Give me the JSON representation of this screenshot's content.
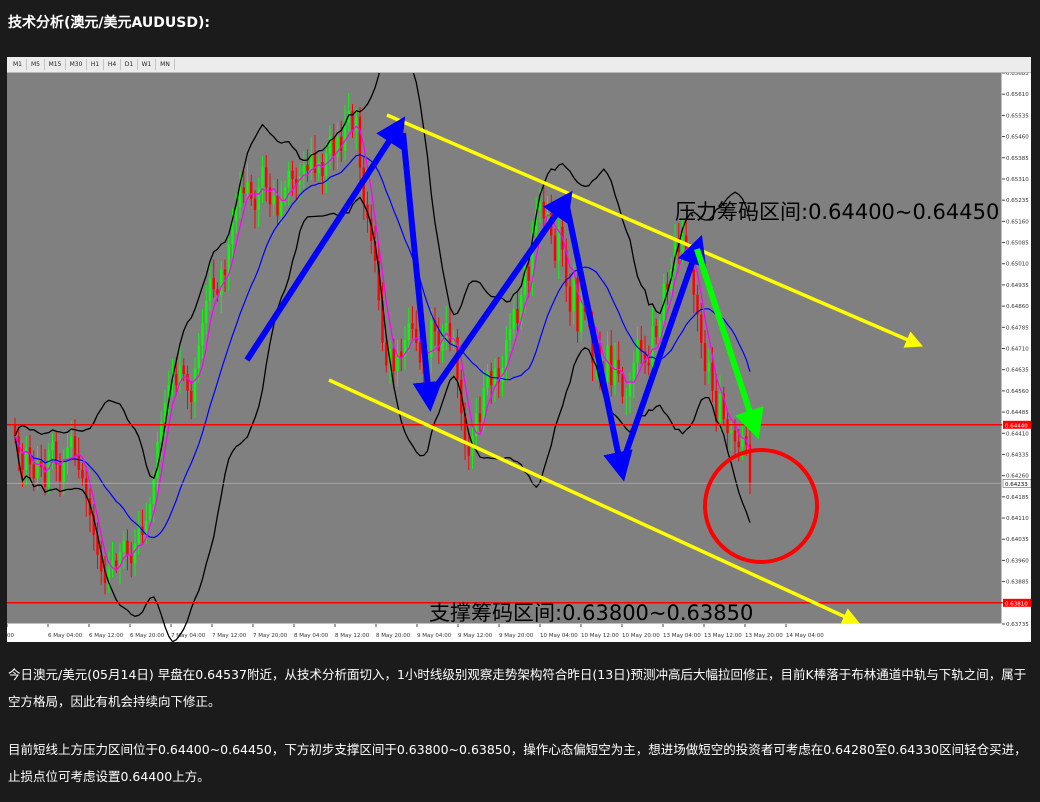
{
  "page": {
    "title": "技术分析(澳元/美元AUDUSD):"
  },
  "timeframes": [
    "M1",
    "M5",
    "M15",
    "M30",
    "H1",
    "H4",
    "D1",
    "W1",
    "MN"
  ],
  "colors": {
    "plot_bg": "#808080",
    "bull_candle": "#00ff00",
    "bear_candle": "#ff0000",
    "bollinger": "#000000",
    "ma_blue": "#0000ff",
    "ma_magenta": "#ff00ff",
    "channel": "#ffff00",
    "hline": "#ff0000",
    "arrow_blue": "#0000ff",
    "arrow_green": "#00ff00",
    "circle": "#ff0000"
  },
  "chart_data": {
    "type": "candlestick",
    "symbol": "AUDUSD",
    "timeframe": "H1",
    "ylim": [
      0.63735,
      0.65685
    ],
    "y_ticks": [
      "0.65685",
      "0.65610",
      "0.65535",
      "0.65460",
      "0.65385",
      "0.65310",
      "0.65235",
      "0.65160",
      "0.65085",
      "0.65010",
      "0.64935",
      "0.64860",
      "0.64785",
      "0.64710",
      "0.64635",
      "0.64560",
      "0.64485",
      "0.64410",
      "0.64335",
      "0.64260",
      "0.64185",
      "0.64110",
      "0.64035",
      "0.63960",
      "0.63885",
      "0.63810",
      "0.63735"
    ],
    "x_ticks": [
      "00",
      "6 May 04:00",
      "6 May 12:00",
      "6 May 20:00",
      "7 May 04:00",
      "7 May 12:00",
      "7 May 20:00",
      "8 May 04:00",
      "8 May 12:00",
      "8 May 20:00",
      "9 May 04:00",
      "9 May 12:00",
      "9 May 20:00",
      "10 May 04:00",
      "10 May 12:00",
      "10 May 20:00",
      "13 May 04:00",
      "13 May 12:00",
      "13 May 20:00",
      "14 May 04:00"
    ],
    "horizontal_levels": [
      {
        "value": 0.6444,
        "label": "0.64440"
      },
      {
        "value": 0.6381,
        "label": "0.63810"
      }
    ],
    "current_price": {
      "value": 0.64233,
      "label": "0.64233"
    },
    "annotations": [
      {
        "text": "压力筹码区间:0.64400~0.64450"
      },
      {
        "text": "支撑筹码区间:0.63800~0.63850"
      }
    ],
    "closes": [
      0.644,
      0.6434,
      0.6428,
      0.6436,
      0.643,
      0.6425,
      0.6431,
      0.6429,
      0.6422,
      0.6435,
      0.6438,
      0.643,
      0.6424,
      0.6431,
      0.6436,
      0.644,
      0.6433,
      0.6428,
      0.6425,
      0.6418,
      0.6412,
      0.6405,
      0.6398,
      0.6392,
      0.6388,
      0.6393,
      0.6396,
      0.6394,
      0.6399,
      0.6403,
      0.6398,
      0.6395,
      0.6402,
      0.6408,
      0.6405,
      0.641,
      0.6416,
      0.6425,
      0.6438,
      0.6445,
      0.6452,
      0.6458,
      0.6462,
      0.6458,
      0.6465,
      0.6462,
      0.6456,
      0.6452,
      0.6464,
      0.6472,
      0.648,
      0.6488,
      0.6496,
      0.6492,
      0.649,
      0.6499,
      0.6497,
      0.6508,
      0.6516,
      0.6521,
      0.6528,
      0.6526,
      0.653,
      0.6524,
      0.652,
      0.6528,
      0.6535,
      0.6528,
      0.6522,
      0.6525,
      0.6518,
      0.6524,
      0.6528,
      0.6534,
      0.6531,
      0.6529,
      0.6532,
      0.6536,
      0.6534,
      0.654,
      0.6533,
      0.6537,
      0.6532,
      0.654,
      0.6546,
      0.6539,
      0.6546,
      0.6541,
      0.6551,
      0.6555,
      0.6548,
      0.6553,
      0.6535,
      0.6522,
      0.6517,
      0.6509,
      0.6502,
      0.6488,
      0.6473,
      0.6465,
      0.6471,
      0.6463,
      0.647,
      0.6468,
      0.6474,
      0.648,
      0.6478,
      0.6473,
      0.6466,
      0.6462,
      0.6468,
      0.6481,
      0.6477,
      0.647,
      0.6474,
      0.648,
      0.6473,
      0.6475,
      0.646,
      0.6448,
      0.6437,
      0.6433,
      0.644,
      0.6448,
      0.6445,
      0.6457,
      0.6463,
      0.6458,
      0.6464,
      0.6459,
      0.6464,
      0.6474,
      0.6478,
      0.6485,
      0.648,
      0.649,
      0.65,
      0.6495,
      0.6512,
      0.652,
      0.6523,
      0.6517,
      0.6519,
      0.6511,
      0.6502,
      0.6514,
      0.6506,
      0.6493,
      0.6484,
      0.6496,
      0.6477,
      0.6488,
      0.6484,
      0.6481,
      0.6466,
      0.6473,
      0.6462,
      0.6459,
      0.6472,
      0.6458,
      0.6467,
      0.6462,
      0.6454,
      0.6454,
      0.6459,
      0.6466,
      0.6474,
      0.647,
      0.6466,
      0.6465,
      0.6479,
      0.6475,
      0.6481,
      0.6494,
      0.6492,
      0.6499,
      0.651,
      0.6505,
      0.6511,
      0.6506,
      0.6499,
      0.649,
      0.6483,
      0.6473,
      0.6463,
      0.6466,
      0.6456,
      0.6445,
      0.6455,
      0.6446,
      0.6441,
      0.6442,
      0.6438,
      0.6436,
      0.644,
      0.6437,
      0.6423
    ]
  },
  "annotation_label_resistance": "压力筹码区间:0.64400~0.64450",
  "annotation_label_support": "支撑筹码区间:0.63800~0.63850",
  "paragraphs": [
    "今日澳元/美元(05月14日) 早盘在0.64537附近，从技术分析面切入，1小时线级别观察走势架构符合昨日(13日)预测冲高后大幅拉回修正，目前K棒落于布林通道中轨与下轨之间，属于空方格局，因此有机会持续向下修正。",
    "目前短线上方压力区间位于0.64400~0.64450，下方初步支撑区间于0.63800~0.63850，操作心态偏短空为主，想进场做短空的投资者可考虑在0.64280至0.64330区间轻仓买进，止损点位可考虑设置0.64400上方。"
  ]
}
